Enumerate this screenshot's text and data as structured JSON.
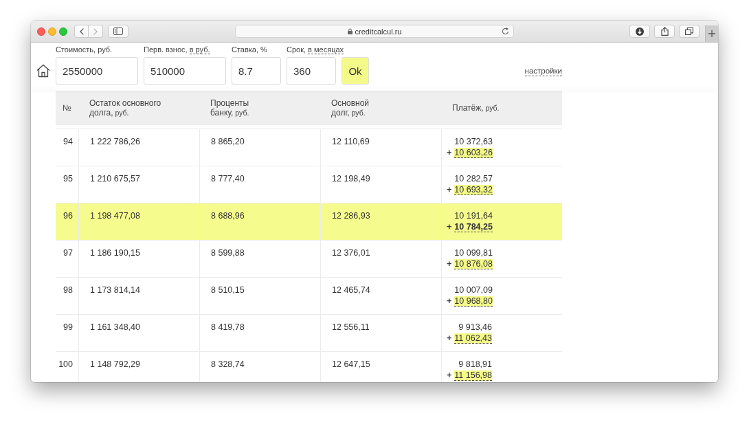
{
  "browser": {
    "nav_buttons": [
      {
        "kind": "back",
        "disabled": false
      },
      {
        "kind": "forward",
        "disabled": true
      }
    ],
    "url": "creditcalcul.ru"
  },
  "form": {
    "fields": [
      {
        "label": "Стоимость, руб.",
        "value": "2550000"
      },
      {
        "label": "Перв. взнос,",
        "link": "в руб.",
        "value": "510000"
      },
      {
        "label": "Ставка, %",
        "value": "8.7"
      },
      {
        "label": "Срок,",
        "link": "в месяцах",
        "value": "360"
      }
    ],
    "submit": "Ok",
    "settings_link": "настройки"
  },
  "table": {
    "columns": [
      {
        "lines": [
          "№"
        ]
      },
      {
        "lines": [
          "Остаток основного",
          "долга,"
        ],
        "unit": "руб."
      },
      {
        "lines": [
          "Проценты",
          "банку,"
        ],
        "unit": "руб."
      },
      {
        "lines": [
          "Основной",
          "долг,"
        ],
        "unit": "руб."
      },
      {
        "lines": [
          "Платёж,"
        ],
        "unit": "руб."
      }
    ],
    "rows": [
      {
        "number": "94",
        "balance": "1 222 786,26",
        "interest": "8 865,20",
        "principal": "12 110,69",
        "payment": "10 372,63",
        "extra_sign": "+",
        "extra_payment": "10 603,26",
        "selected": false
      },
      {
        "number": "95",
        "balance": "1 210 675,57",
        "interest": "8 777,40",
        "principal": "12 198,49",
        "payment": "10 282,57",
        "extra_sign": "+",
        "extra_payment": "10 693,32",
        "selected": false
      },
      {
        "number": "96",
        "balance": "1 198 477,08",
        "interest": "8 688,96",
        "principal": "12 286,93",
        "payment": "10 191,64",
        "extra_sign": "+",
        "extra_payment": "10 784,25",
        "selected": true
      },
      {
        "number": "97",
        "balance": "1 186 190,15",
        "interest": "8 599,88",
        "principal": "12 376,01",
        "payment": "10 099,81",
        "extra_sign": "+",
        "extra_payment": "10 876,08",
        "selected": false
      },
      {
        "number": "98",
        "balance": "1 173 814,14",
        "interest": "8 510,15",
        "principal": "12 465,74",
        "payment": "10 007,09",
        "extra_sign": "+",
        "extra_payment": "10 968,80",
        "selected": false
      },
      {
        "number": "99",
        "balance": "1 161 348,40",
        "interest": "8 419,78",
        "principal": "12 556,11",
        "payment": "9 913,46",
        "extra_sign": "+",
        "extra_payment": "11 062,43",
        "selected": false
      },
      {
        "number": "100",
        "balance": "1 148 792,29",
        "interest": "8 328,74",
        "principal": "12 647,15",
        "payment": "9 818,91",
        "extra_sign": "+",
        "extra_payment": "11 156,98",
        "selected": false
      }
    ]
  }
}
